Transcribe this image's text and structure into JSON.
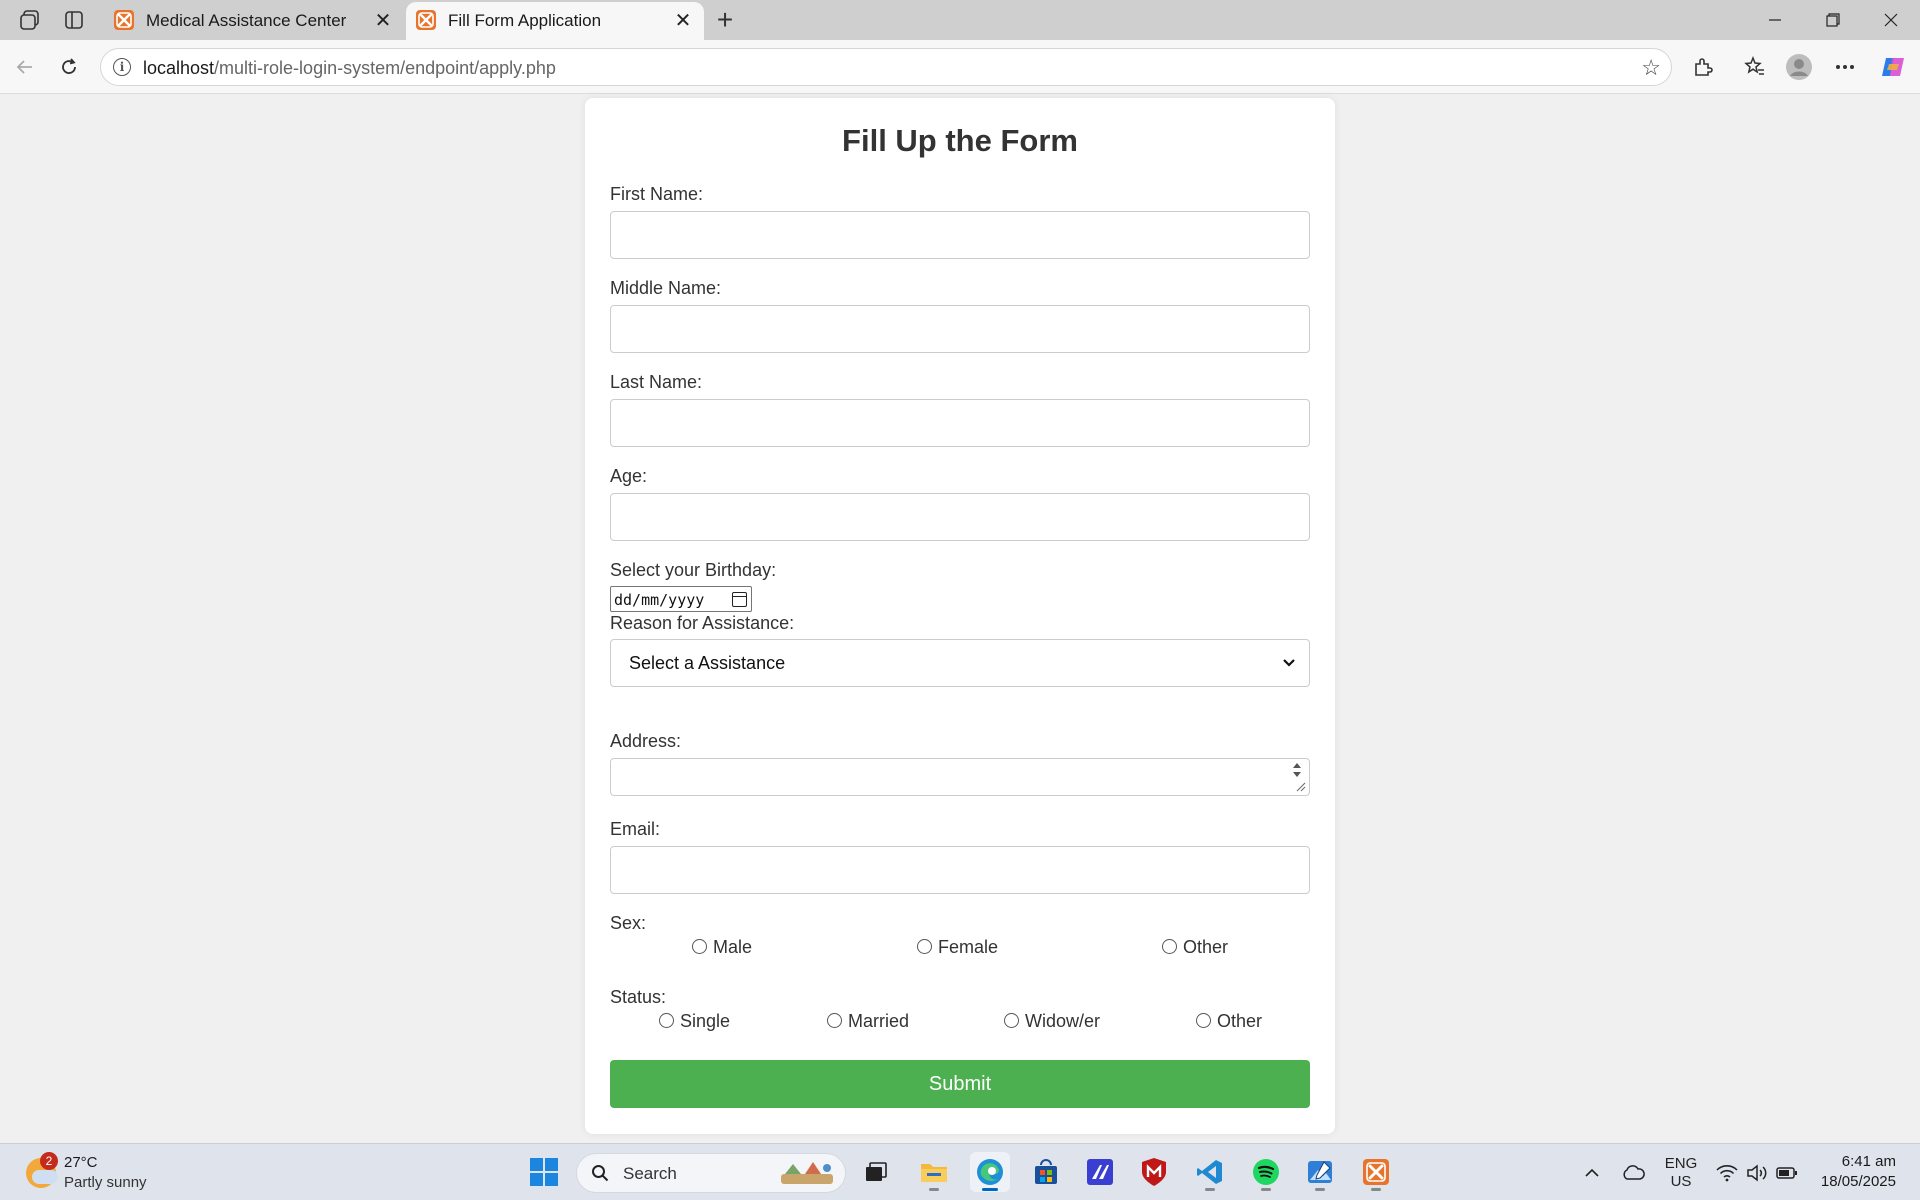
{
  "browser": {
    "tabs": [
      {
        "title": "Medical Assistance Center",
        "active": false
      },
      {
        "title": "Fill Form Application",
        "active": true
      }
    ],
    "url_host": "localhost",
    "url_path": "/multi-role-login-system/endpoint/apply.php"
  },
  "form": {
    "title": "Fill Up the Form",
    "first_name_label": "First Name:",
    "middle_name_label": "Middle Name:",
    "last_name_label": "Last Name:",
    "age_label": "Age:",
    "birthday_label": "Select your Birthday:",
    "birthday_placeholder": "dd/mm/yyyy",
    "reason_label": "Reason for Assistance:",
    "reason_selected": "Select a Assistance",
    "address_label": "Address:",
    "email_label": "Email:",
    "sex_label": "Sex:",
    "sex_options": [
      "Male",
      "Female",
      "Other"
    ],
    "status_label": "Status:",
    "status_options": [
      "Single",
      "Married",
      "Widow/er",
      "Other"
    ],
    "submit_label": "Submit",
    "submit_color": "#4caf50"
  },
  "taskbar": {
    "weather_temp": "27°C",
    "weather_condition": "Partly sunny",
    "weather_badge": "2",
    "search_label": "Search",
    "lang_top": "ENG",
    "lang_bottom": "US",
    "time": "6:41 am",
    "date": "18/05/2025"
  }
}
